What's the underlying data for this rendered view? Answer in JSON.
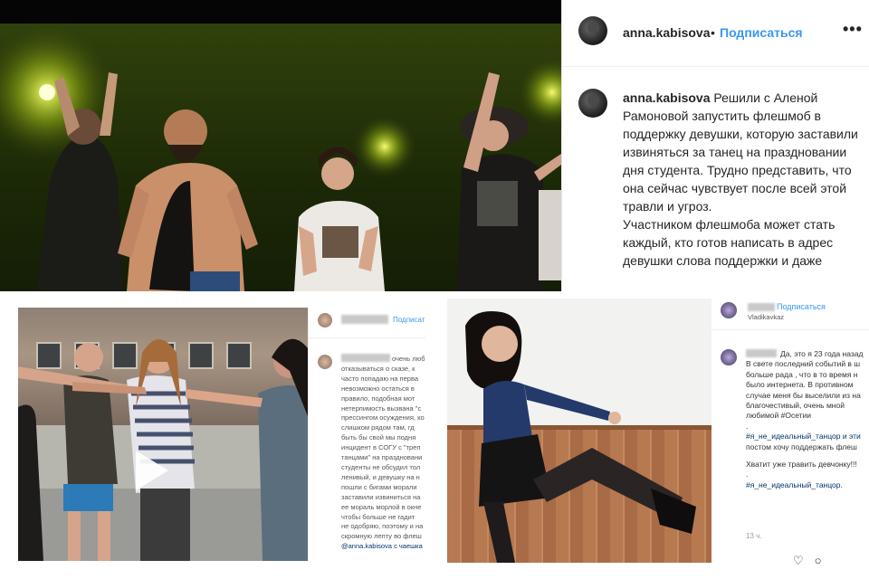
{
  "post": {
    "username": "anna.kabisova",
    "separator": "•",
    "follow_label": "Подписаться",
    "more_label": "•••",
    "caption_author": "anna.kabisova",
    "caption_p1": "Решили с Аленой Рамоновой запустить флешмоб в поддержку девушки, которую заставили извиняться за танец на праздновании дня студента. Трудно представить, что она сейчас чувствует после всей этой травли и угроз.",
    "caption_p2": "Участником флешмоба может стать каждый, кто готов написать в адрес девушки слова поддержки и даже"
  },
  "video_post": {
    "follow_label": "Подписат",
    "comment_lines": [
      "очень люб",
      "отказываться о сказе, к",
      "часто попадаю на перва",
      "невозможно остаться в",
      "правило, подобная мот",
      "нетерпимость вызвана \"с",
      "прессингом осуждения, ко",
      "слишком рядом там, гд",
      "быть бы свой мы подня",
      "инцидент в СОГУ с \"треп",
      "танцами\" на праздновани",
      "студенты не обсудил тол",
      "ленивый, и девушку на н",
      "пошли с бигами морали",
      "заставили извиниться на",
      "ее мораль морлой в окне",
      "чтобы больше не гадит",
      "не одобряю, поэтому и на",
      "скромную лепту во флеш",
      "@anna.kabisova с чаешка"
    ]
  },
  "photo_post": {
    "follow_label": "Подписаться",
    "subtitle": "Vladikavkaz",
    "comment_lines": [
      "Да, это я 23 года назад",
      "В свете последний событий в ш",
      "больше рада , что в то время н",
      "было интернета. В противном",
      "случае меня бы выселили из на",
      "благочестивый, очень мной",
      "любимой #Осетии"
    ],
    "hashtag_line_1": "#я_не_идеальный_танцор и эти",
    "comment_line_8": "постом хочу поддержать флеш",
    "comment_line_9": "Хватит уже травить девчонку!!!",
    "hashtag_line_2": "#я_не_идеальный_танцор.",
    "dot": ".",
    "time": "13 ч."
  }
}
